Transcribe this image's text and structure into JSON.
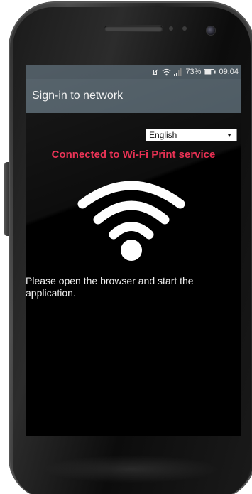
{
  "status_bar": {
    "mute_icon": "vibrate-off-icon",
    "wifi_icon": "wifi-signal-icon",
    "signal_icon": "cell-signal-icon",
    "battery_percent": "73%",
    "battery_level": 0.73,
    "time": "09:04"
  },
  "app_bar": {
    "title": "Sign-in to network"
  },
  "content": {
    "language_select": {
      "selected": "English",
      "caret": "▼"
    },
    "connected_message": "Connected to Wi-Fi Print service",
    "wifi_icon": "wifi-icon",
    "instruction": "Please open the browser and start the application."
  },
  "colors": {
    "app_bar": "#44525b",
    "status_bar": "#3d4a53",
    "accent_red": "#e8254a",
    "screen_bg": "#000000"
  }
}
